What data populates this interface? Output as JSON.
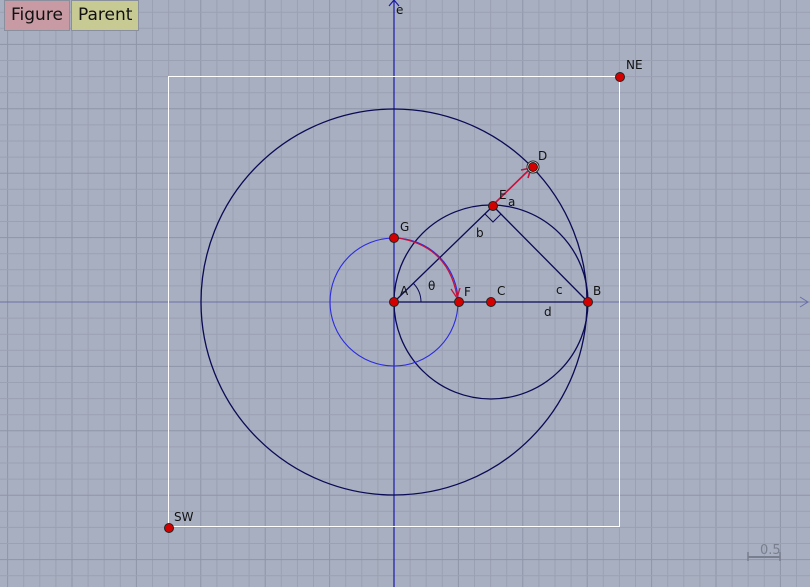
{
  "toolbar": {
    "figure_label": "Figure",
    "parent_label": "Parent"
  },
  "colors": {
    "background": "#a8afc0",
    "grid_minor": "#9aa1b3",
    "grid_major": "#8e95a8",
    "axis": "#1a1aa6",
    "dark_curve": "#0a0a55",
    "blue_circle": "#2a2ae0",
    "red_arrow": "#c8103c",
    "point_fill": "#d40000",
    "frame": "#ffffff"
  },
  "labels": {
    "axis_e": "e",
    "ne": "NE",
    "sw": "SW",
    "A": "A",
    "B": "B",
    "C": "C",
    "D": "D",
    "E": "E",
    "F": "F",
    "G": "G",
    "a": "a",
    "b": "b",
    "c": "c",
    "d": "d",
    "theta": "θ"
  },
  "scale_bar": {
    "label": "0.5"
  }
}
